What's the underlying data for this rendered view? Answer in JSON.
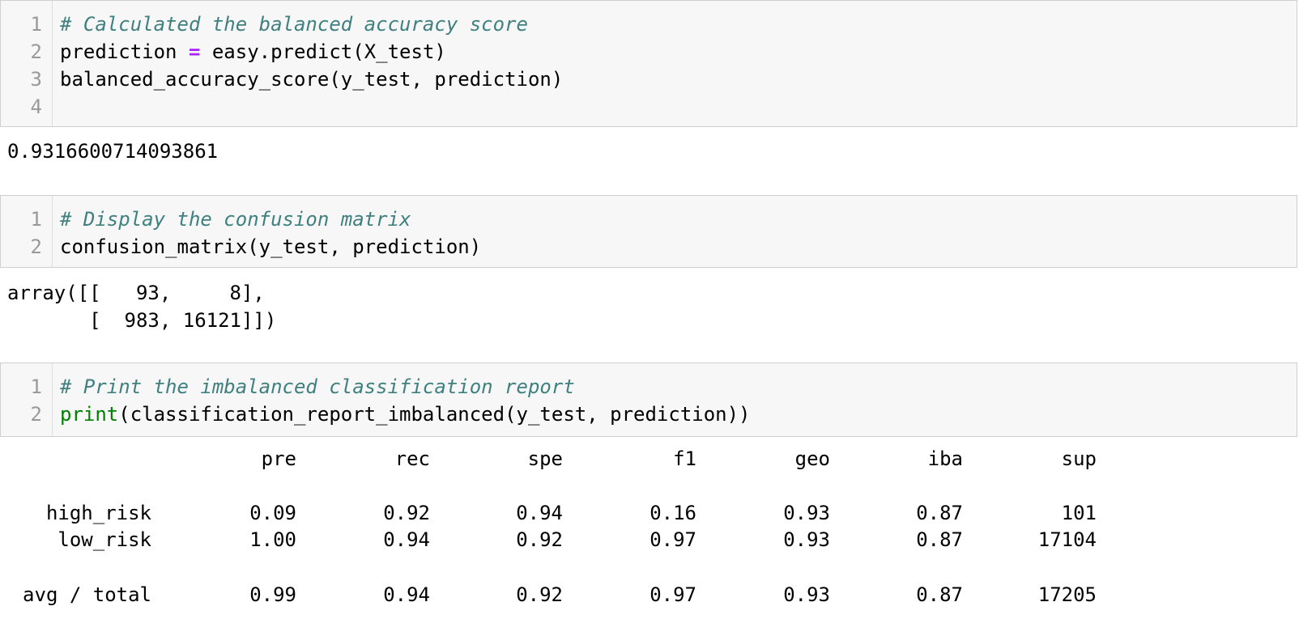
{
  "cells": [
    {
      "gutter": [
        "1",
        "2",
        "3",
        "4"
      ],
      "code": [
        [
          {
            "t": "# Calculated the balanced accuracy score",
            "c": "comment"
          }
        ],
        [
          {
            "t": "prediction ",
            "c": ""
          },
          {
            "t": "=",
            "c": "op"
          },
          {
            "t": " easy.predict(X_test)",
            "c": ""
          }
        ],
        [
          {
            "t": "balanced_accuracy_score(y_test, prediction)",
            "c": ""
          }
        ],
        [
          {
            "t": "",
            "c": ""
          }
        ]
      ],
      "output": [
        "0.9316600714093861"
      ]
    },
    {
      "gutter": [
        "1",
        "2"
      ],
      "code": [
        [
          {
            "t": "# Display the confusion matrix",
            "c": "comment"
          }
        ],
        [
          {
            "t": "confusion_matrix(y_test, prediction)",
            "c": ""
          }
        ]
      ],
      "output": [
        "array([[   93,     8],",
        "       [  983, 16121]])"
      ]
    },
    {
      "gutter": [
        "1",
        "2"
      ],
      "code": [
        [
          {
            "t": "# Print the imbalanced classification report",
            "c": "comment"
          }
        ],
        [
          {
            "t": "print",
            "c": "builtin"
          },
          {
            "t": "(classification_report_imbalanced(y_test, prediction))",
            "c": ""
          }
        ]
      ]
    }
  ],
  "report": {
    "headers": [
      "pre",
      "rec",
      "spe",
      "f1",
      "geo",
      "iba",
      "sup"
    ],
    "rows": [
      {
        "label": "high_risk",
        "values": [
          "0.09",
          "0.92",
          "0.94",
          "0.16",
          "0.93",
          "0.87",
          "101"
        ]
      },
      {
        "label": "low_risk",
        "values": [
          "1.00",
          "0.94",
          "0.92",
          "0.97",
          "0.93",
          "0.87",
          "17104"
        ]
      },
      {
        "label": "avg / total",
        "values": [
          "0.99",
          "0.94",
          "0.92",
          "0.97",
          "0.93",
          "0.87",
          "17205"
        ]
      }
    ]
  }
}
